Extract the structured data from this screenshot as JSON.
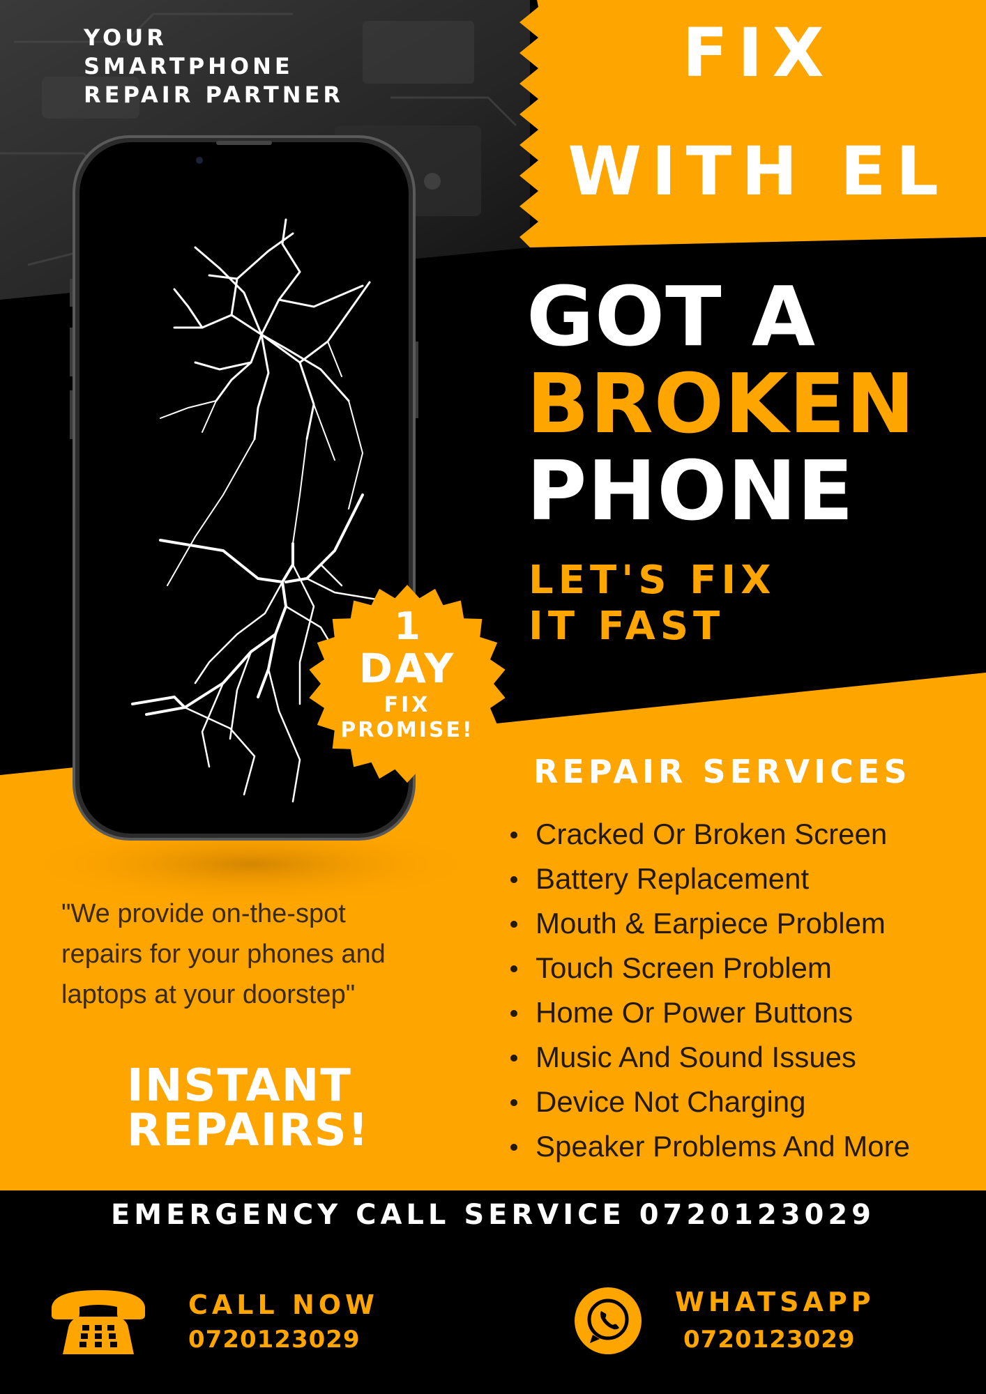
{
  "colors": {
    "accent": "#FFA500",
    "black": "#000000",
    "white": "#FFFFFF",
    "dark_text": "#231A0B"
  },
  "header": {
    "tagline_lines": [
      "YOUR",
      "SMARTPHONE",
      "REPAIR PARTNER"
    ],
    "brand_lines": [
      "FIX",
      "WITH EL"
    ]
  },
  "headline": {
    "line1": "GOT A",
    "line2": "BROKEN",
    "line3": "PHONE"
  },
  "subheadline_lines": [
    "LET'S FIX",
    "IT FAST"
  ],
  "badge": {
    "number": "1",
    "unit": "DAY",
    "line3": "FIX",
    "line4": "PROMISE!"
  },
  "services": {
    "title": "REPAIR SERVICES",
    "items": [
      "Cracked Or Broken Screen",
      "Battery Replacement",
      "Mouth & Earpiece Problem",
      "Touch Screen Problem",
      "Home Or Power Buttons",
      "Music And Sound Issues",
      "Device Not Charging",
      "Speaker Problems And More"
    ]
  },
  "quote_lines": [
    "\"We provide on-the-spot",
    "repairs for your phones and",
    "laptops at your doorstep\""
  ],
  "instant_lines": [
    "INSTANT",
    "REPAIRS!"
  ],
  "footer": {
    "emergency": "EMERGENCY CALL SERVICE 0720123029",
    "call": {
      "label": "CALL NOW",
      "number": "0720123029",
      "icon": "telephone-icon"
    },
    "whatsapp": {
      "label": "WHATSAPP",
      "number": "0720123029",
      "icon": "whatsapp-icon"
    }
  },
  "images": {
    "phone": "smartphone-cracked-screen"
  }
}
